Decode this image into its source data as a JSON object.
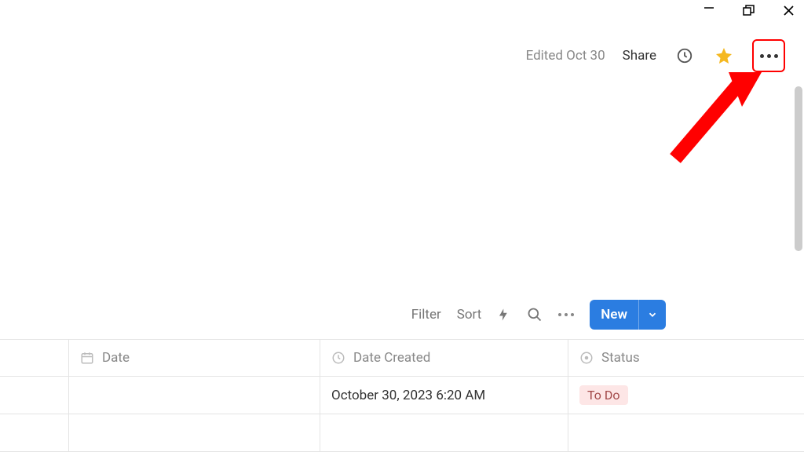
{
  "window": {
    "minimize": "—",
    "maximize": "❐",
    "close": "✕"
  },
  "topbar": {
    "edited": "Edited Oct 30",
    "share": "Share"
  },
  "toolbar": {
    "filter": "Filter",
    "sort": "Sort",
    "new_label": "New"
  },
  "table": {
    "headers": {
      "date": "Date",
      "date_created": "Date Created",
      "status": "Status"
    },
    "rows": [
      {
        "date": "",
        "date_created": "October 30, 2023 6:20 AM",
        "status": "To Do"
      }
    ]
  }
}
